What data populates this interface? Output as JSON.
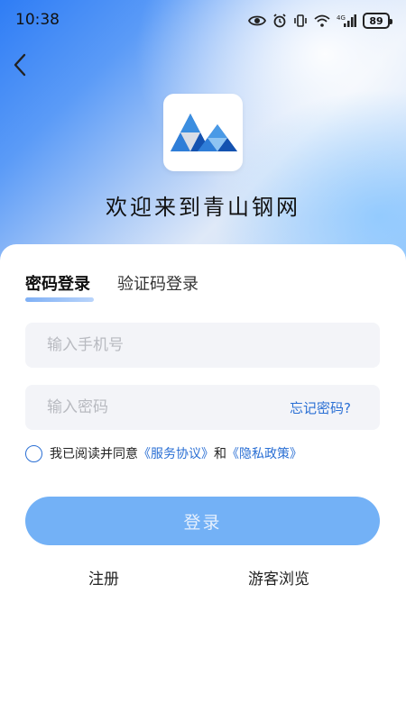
{
  "status_bar": {
    "time": "10:38",
    "battery": "89",
    "icons": [
      "eye-icon",
      "alarm-icon",
      "vibrate-icon",
      "wifi-icon",
      "signal-4g-icon",
      "battery-icon"
    ]
  },
  "header": {
    "back_icon": "chevron-left-icon",
    "welcome": "欢迎来到青山钢网"
  },
  "tabs": [
    {
      "label": "密码登录",
      "active": true
    },
    {
      "label": "验证码登录",
      "active": false
    }
  ],
  "form": {
    "phone_placeholder": "输入手机号",
    "password_placeholder": "输入密码",
    "forgot_label": "忘记密码?"
  },
  "agreement": {
    "prefix": "我已阅读并同意",
    "service_link": "《服务协议》",
    "and_text": "和",
    "privacy_link": "《隐私政策》"
  },
  "actions": {
    "login_label": "登录",
    "register_label": "注册",
    "guest_label": "游客浏览"
  },
  "colors": {
    "accent": "#2a6fd4",
    "button": "#73b1f6",
    "field_bg": "#f3f4f8"
  }
}
